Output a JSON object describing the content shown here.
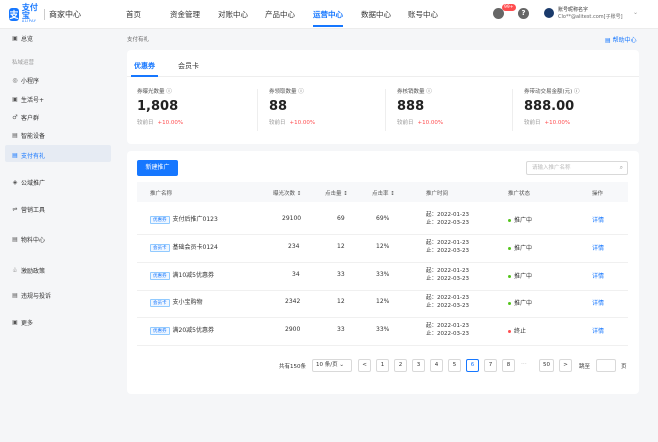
{
  "header": {
    "logo_cn": "支付宝",
    "logo_en": "ALIPAY",
    "logo_sub": "商家中心",
    "nav": [
      "首页",
      "资金管理",
      "对账中心",
      "产品中心",
      "运营中心",
      "数据中心",
      "账号中心"
    ],
    "active_nav": "运营中心",
    "badge": "99+",
    "account_name": "账号昵称名字",
    "account_id": "Clo**@alitest.com[子账号]"
  },
  "sidebar": {
    "overview": "总览",
    "group_label": "私域运营",
    "items": [
      {
        "icon": "mini-program-icon",
        "glyph": "◎",
        "label": "小程序"
      },
      {
        "icon": "life-account-icon",
        "glyph": "▣",
        "label": "生活号+"
      },
      {
        "icon": "customer-group-icon",
        "glyph": "♂",
        "label": "客户群"
      },
      {
        "icon": "smart-device-icon",
        "glyph": "▤",
        "label": "智能设备"
      },
      {
        "icon": "gift-icon",
        "glyph": "▤",
        "label": "支付有礼"
      }
    ],
    "sections": [
      {
        "icon": "public-promo-icon",
        "glyph": "◈",
        "label": "公域推广"
      },
      {
        "icon": "marketing-tools-icon",
        "glyph": "⇌",
        "label": "营销工具"
      },
      {
        "icon": "materials-icon",
        "glyph": "▤",
        "label": "物料中心"
      },
      {
        "icon": "incentive-icon",
        "glyph": "♧",
        "label": "激励政策"
      },
      {
        "icon": "violation-icon",
        "glyph": "▤",
        "label": "违规与投诉"
      },
      {
        "icon": "more-icon",
        "glyph": "▣",
        "label": "更多"
      }
    ]
  },
  "main": {
    "breadcrumb": "支付有礼",
    "help_link": "帮助中心",
    "tabs": [
      "优惠券",
      "会员卡"
    ],
    "stats": [
      {
        "label": "券曝光数量",
        "value": "1,808",
        "compare_label": "较前日",
        "change": "+10.00%"
      },
      {
        "label": "券领取数量",
        "value": "88",
        "compare_label": "较前日",
        "change": "+10.00%"
      },
      {
        "label": "券核销数量",
        "value": "888",
        "compare_label": "较前日",
        "change": "+10.00%"
      },
      {
        "label": "券带动交易金额(元)",
        "value": "888.00",
        "compare_label": "较前日",
        "change": "+10.00%"
      }
    ],
    "new_button": "新建推广",
    "search_placeholder": "请输入推广名称",
    "table": {
      "headers": [
        "推广名称",
        "曝光次数 ↕",
        "点击量 ↕",
        "点击率 ↕",
        "推广时间",
        "推广状态",
        "操作"
      ],
      "rows": [
        {
          "tag": "优惠券",
          "name": "支付后推广0123",
          "views": "29100",
          "clicks": "69",
          "ctr": "69%",
          "start": "起：2022-01-23",
          "end": "止：2022-03-23",
          "status": "推广中",
          "status_color": "#52c41a",
          "action": "详情"
        },
        {
          "tag": "会员卡",
          "name": "基础会员卡0124",
          "views": "234",
          "clicks": "12",
          "ctr": "12%",
          "start": "起：2022-01-23",
          "end": "止：2022-03-23",
          "status": "推广中",
          "status_color": "#52c41a",
          "action": "详情"
        },
        {
          "tag": "优惠券",
          "name": "满10减5优惠券",
          "views": "34",
          "clicks": "33",
          "ctr": "33%",
          "start": "起：2022-01-23",
          "end": "止：2022-03-23",
          "status": "推广中",
          "status_color": "#52c41a",
          "action": "详情"
        },
        {
          "tag": "会员卡",
          "name": "支小宝购物",
          "views": "2342",
          "clicks": "12",
          "ctr": "12%",
          "start": "起：2022-01-23",
          "end": "止：2022-03-23",
          "status": "推广中",
          "status_color": "#52c41a",
          "action": "详情"
        },
        {
          "tag": "优惠券",
          "name": "满20减5优惠券",
          "views": "2900",
          "clicks": "33",
          "ctr": "33%",
          "start": "起：2022-01-23",
          "end": "止：2022-03-23",
          "status": "终止",
          "status_color": "#ff4d4f",
          "action": "详情"
        }
      ]
    },
    "pagination": {
      "total": "共有150条",
      "page_size": "10 条/页",
      "prev": "<",
      "pages": [
        "1",
        "2",
        "3",
        "4",
        "5",
        "6",
        "7",
        "8"
      ],
      "current": "6",
      "ellipsis": "···",
      "last": "50",
      "next": ">",
      "jump_label": "跳至",
      "jump_suffix": "页"
    }
  }
}
